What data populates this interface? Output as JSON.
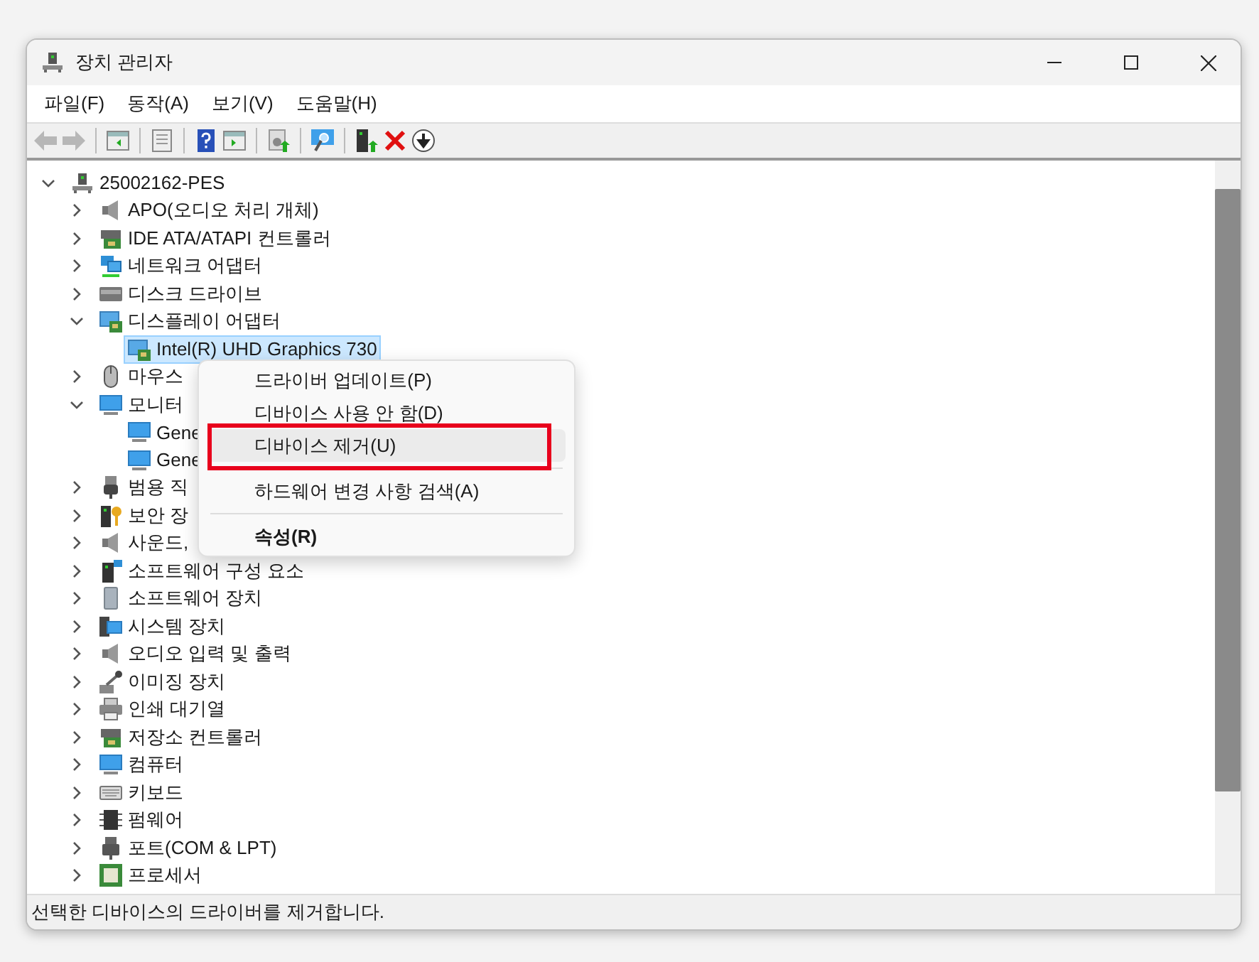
{
  "window": {
    "title": "장치 관리자"
  },
  "menu_bar": [
    {
      "label": "파일(F)"
    },
    {
      "label": "동작(A)"
    },
    {
      "label": "보기(V)"
    },
    {
      "label": "도움말(H)"
    }
  ],
  "toolbar": [
    {
      "kind": "button",
      "disabled": true
    },
    {
      "kind": "button",
      "disabled": true
    },
    {
      "kind": "separator"
    },
    {
      "kind": "button",
      "disabled": false
    },
    {
      "kind": "separator"
    },
    {
      "kind": "button",
      "disabled": false
    },
    {
      "kind": "separator"
    },
    {
      "kind": "button",
      "disabled": false
    },
    {
      "kind": "button",
      "disabled": false
    },
    {
      "kind": "separator"
    },
    {
      "kind": "button",
      "disabled": false
    },
    {
      "kind": "separator"
    },
    {
      "kind": "button",
      "disabled": false
    },
    {
      "kind": "separator"
    },
    {
      "kind": "button",
      "disabled": false
    },
    {
      "kind": "button",
      "disabled": false
    },
    {
      "kind": "button",
      "disabled": false
    }
  ],
  "tree": [
    {
      "label": "25002162-PES",
      "expanded": true,
      "selected": false,
      "children": [
        {
          "label": "APO(오디오 처리 개체)",
          "expanded": false,
          "selected": false
        },
        {
          "label": "IDE ATA/ATAPI 컨트롤러",
          "expanded": false,
          "selected": false
        },
        {
          "label": "네트워크 어댑터",
          "expanded": false,
          "selected": false
        },
        {
          "label": "디스크 드라이브",
          "expanded": false,
          "selected": false
        },
        {
          "label": "디스플레이 어댑터",
          "expanded": true,
          "selected": false,
          "children": [
            {
              "label": "Intel(R) UHD Graphics 730",
              "selected": true
            }
          ]
        },
        {
          "label": "마우스",
          "expanded": false,
          "selected": false
        },
        {
          "label": "모니터",
          "expanded": true,
          "selected": false,
          "children": [
            {
              "label": "Gene",
              "selected": false
            },
            {
              "label": "Gene",
              "selected": false
            }
          ]
        },
        {
          "label": "범용 직",
          "expanded": false,
          "selected": false
        },
        {
          "label": "보안 장",
          "expanded": false,
          "selected": false
        },
        {
          "label": "사운드,",
          "expanded": false,
          "selected": false
        },
        {
          "label": "소프트웨어 구성 요소",
          "expanded": false,
          "selected": false
        },
        {
          "label": "소프트웨어 장치",
          "expanded": false,
          "selected": false
        },
        {
          "label": "시스템 장치",
          "expanded": false,
          "selected": false
        },
        {
          "label": "오디오 입력 및 출력",
          "expanded": false,
          "selected": false
        },
        {
          "label": "이미징 장치",
          "expanded": false,
          "selected": false
        },
        {
          "label": "인쇄 대기열",
          "expanded": false,
          "selected": false
        },
        {
          "label": "저장소 컨트롤러",
          "expanded": false,
          "selected": false
        },
        {
          "label": "컴퓨터",
          "expanded": false,
          "selected": false
        },
        {
          "label": "키보드",
          "expanded": false,
          "selected": false
        },
        {
          "label": "펌웨어",
          "expanded": false,
          "selected": false
        },
        {
          "label": "포트(COM & LPT)",
          "expanded": false,
          "selected": false
        },
        {
          "label": "프로세서",
          "expanded": false,
          "selected": false
        }
      ]
    }
  ],
  "context_menu": [
    {
      "kind": "item",
      "label": "드라이버 업데이트(P)",
      "selected": false,
      "default": false,
      "outlined": false
    },
    {
      "kind": "item",
      "label": "디바이스 사용 안 함(D)",
      "selected": false,
      "default": false,
      "outlined": false
    },
    {
      "kind": "item",
      "label": "디바이스 제거(U)",
      "selected": true,
      "default": false,
      "outlined": true
    },
    {
      "kind": "separator"
    },
    {
      "kind": "item",
      "label": "하드웨어 변경 사항 검색(A)",
      "selected": false,
      "default": false,
      "outlined": false
    },
    {
      "kind": "separator"
    },
    {
      "kind": "item",
      "label": "속성(R)",
      "selected": false,
      "default": true,
      "outlined": false
    }
  ],
  "status_bar": {
    "text": "선택한 디바이스의 드라이버를 제거합니다."
  }
}
